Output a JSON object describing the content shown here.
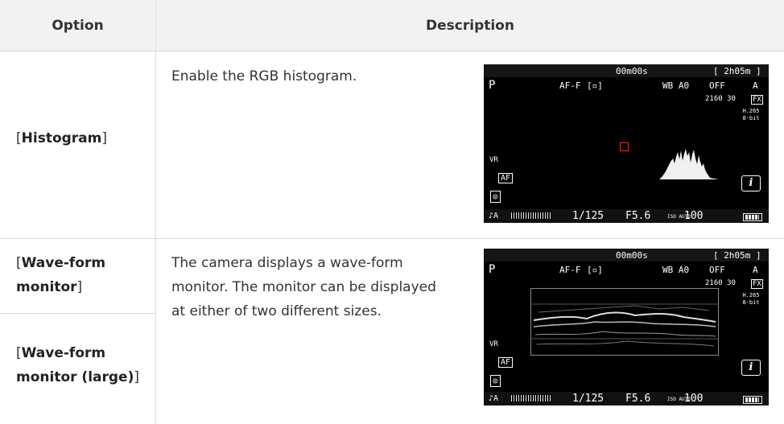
{
  "table": {
    "headers": {
      "option": "Option",
      "description": "Description"
    },
    "rows": [
      {
        "option": [
          "Histogram"
        ],
        "description": "Enable the RGB histogram."
      },
      {
        "option": [
          "Wave-form monitor",
          "Wave-form monitor (large)"
        ],
        "description_lines": [
          "The camera displays a wave-form",
          "monitor. The monitor can be displayed",
          "at either of two different sizes."
        ]
      }
    ]
  },
  "display": {
    "timecode": "00m00s",
    "remaining": "[ 2h05m ]",
    "mode": "P",
    "af_mode": "AF-F",
    "af_area": "[▫]",
    "wb": "WB A0",
    "picture_control": "OFF",
    "quality": "A",
    "frame_size": "2160 30",
    "fx": "FX",
    "codec": "H.265 8-bit",
    "vr": "VR",
    "af_label": "AF",
    "metering": "⊙",
    "mic": "♪A",
    "shutter": "1/125",
    "aperture": "F5.6",
    "iso_label": "ISO AUTO",
    "iso": "100",
    "info_button": "i"
  }
}
